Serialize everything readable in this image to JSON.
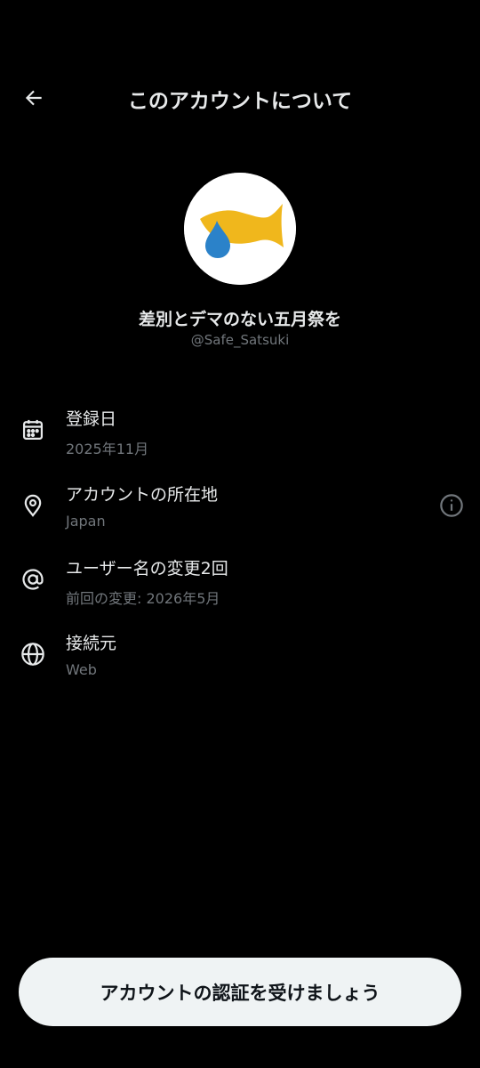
{
  "header": {
    "title": "このアカウントについて",
    "back_icon": "arrow-left-icon"
  },
  "profile": {
    "display_name": "差別とデマのない五月祭を",
    "handle": "@Safe_Satsuki",
    "avatar": {
      "description_colors": {
        "background": "#ffffff",
        "fish": "#f0b71c",
        "drop": "#2b82c9"
      }
    }
  },
  "info": [
    {
      "icon": "calendar-icon",
      "label": "登録日",
      "value": "2025年11月"
    },
    {
      "icon": "location-pin-icon",
      "label": "アカウントの所在地",
      "value": "Japan",
      "action_icon": "info-circle-icon"
    },
    {
      "icon": "at-sign-icon",
      "label": "ユーザー名の変更2回",
      "value": "前回の変更: 2026年5月"
    },
    {
      "icon": "globe-icon",
      "label": "接続元",
      "value": "Web"
    }
  ],
  "footer": {
    "verify_label": "アカウントの認証を受けましょう"
  },
  "colors": {
    "background": "#000000",
    "primary_text": "#e7e9ea",
    "secondary_text": "#71767b",
    "button_bg": "#eff3f4",
    "button_text": "#0f1419"
  }
}
